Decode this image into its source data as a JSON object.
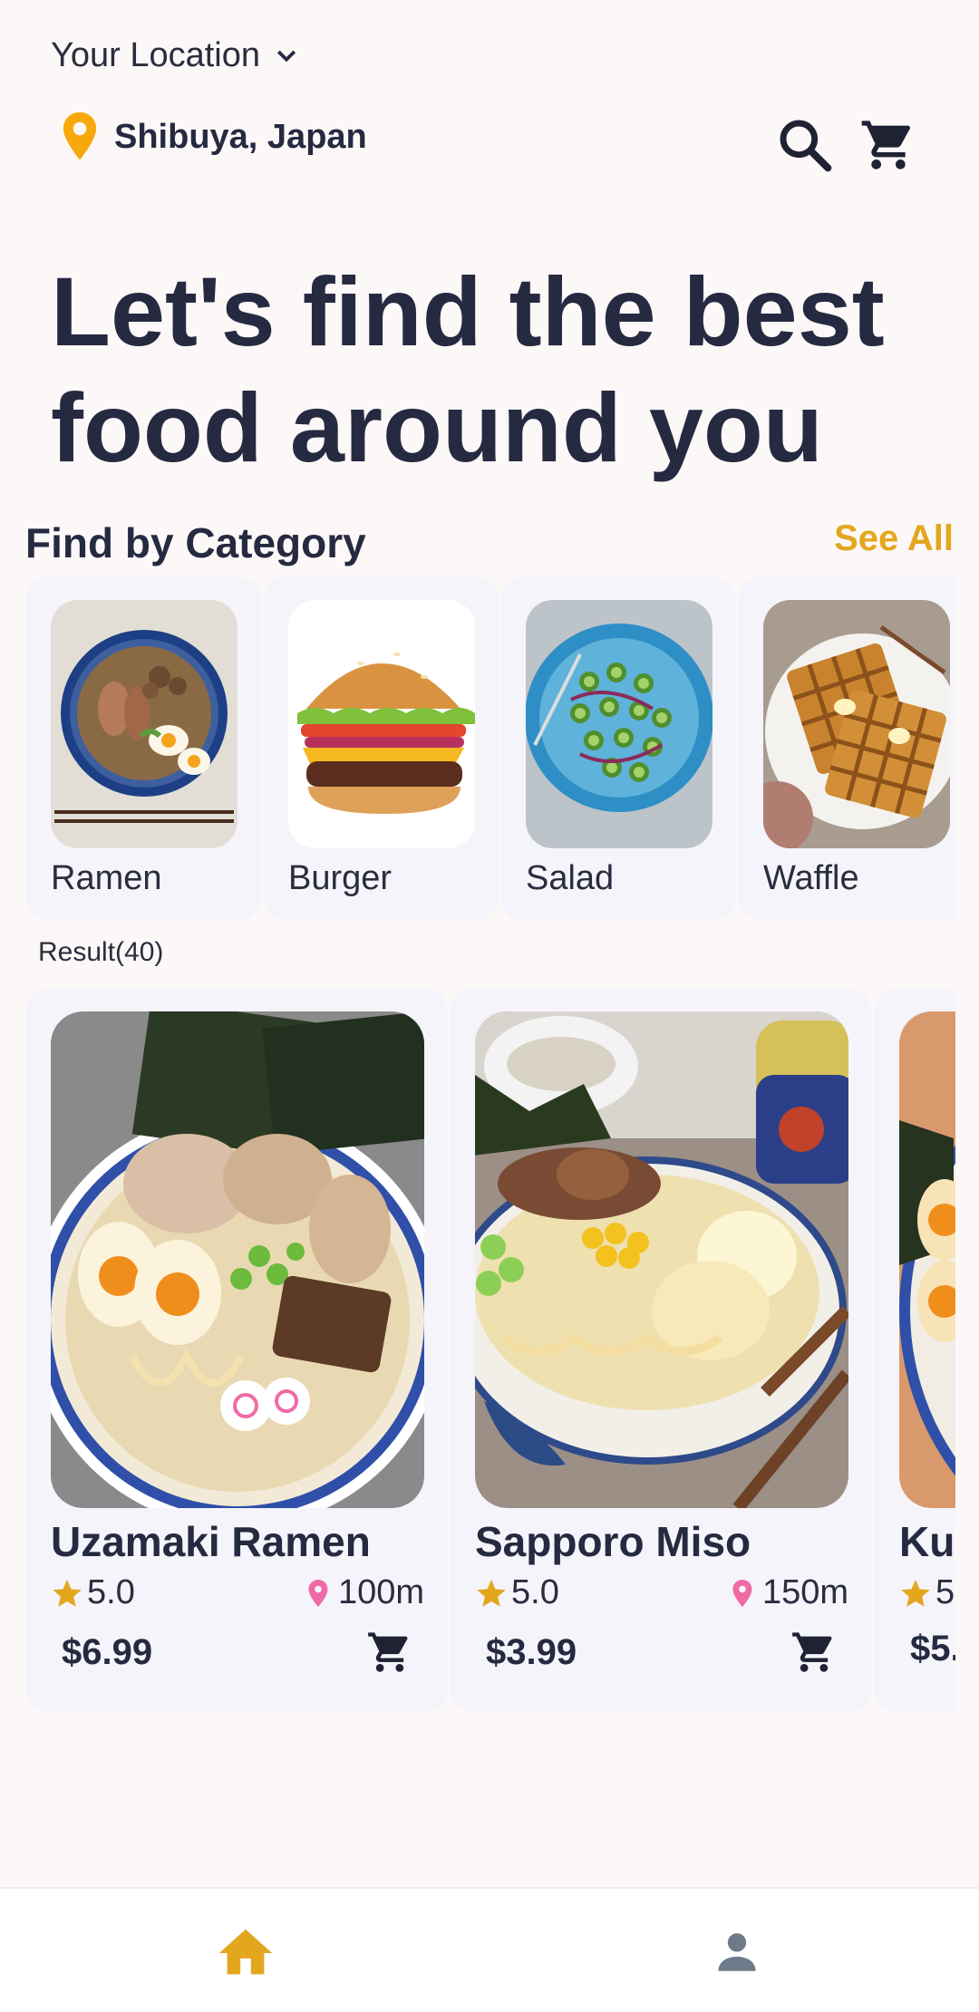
{
  "header": {
    "location_label": "Your Location",
    "location_value": "Shibuya, Japan"
  },
  "hero": {
    "line1": "Let's find the best",
    "line2": "food around you"
  },
  "category": {
    "title": "Find by Category",
    "see_all": "See All",
    "items": [
      {
        "label": "Ramen",
        "icon": "ramen-image"
      },
      {
        "label": "Burger",
        "icon": "burger-image"
      },
      {
        "label": "Salad",
        "icon": "salad-image"
      },
      {
        "label": "Waffle",
        "icon": "waffle-image"
      }
    ]
  },
  "results": {
    "label": "Result(40)",
    "items": [
      {
        "name": "Uzamaki Ramen",
        "rating": "5.0",
        "distance": "100m",
        "price": "$6.99"
      },
      {
        "name": "Sapporo Miso",
        "rating": "5.0",
        "distance": "150m",
        "price": "$3.99"
      },
      {
        "name": "Ku",
        "rating": "5",
        "distance": "",
        "price": "$5."
      }
    ]
  },
  "colors": {
    "accent": "#e3a71f",
    "pin": "#f7a90c",
    "text": "#262a41",
    "pink": "#f06aa6",
    "nav_inactive": "#6c7a89"
  },
  "icons": [
    "chevron-down-icon",
    "location-pin-icon",
    "search-icon",
    "cart-icon",
    "star-icon",
    "home-icon",
    "profile-icon"
  ]
}
